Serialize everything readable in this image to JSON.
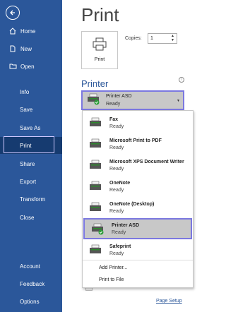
{
  "sidebar": {
    "items": [
      {
        "label": "Home",
        "icon": "home-icon"
      },
      {
        "label": "New",
        "icon": "new-document-icon"
      },
      {
        "label": "Open",
        "icon": "folder-icon"
      },
      {
        "label": "Info"
      },
      {
        "label": "Save"
      },
      {
        "label": "Save As"
      },
      {
        "label": "Print"
      },
      {
        "label": "Share"
      },
      {
        "label": "Export"
      },
      {
        "label": "Transform"
      },
      {
        "label": "Close"
      },
      {
        "label": "Account"
      },
      {
        "label": "Feedback"
      },
      {
        "label": "Options"
      }
    ],
    "active": "Print",
    "bg_color": "#2b579a"
  },
  "main": {
    "title": "Print",
    "print_button_label": "Print",
    "copies_label": "Copies:",
    "copies_value": "1",
    "printer_section_title": "Printer",
    "selected_printer": {
      "name": "Printer ASD",
      "status": "Ready"
    },
    "page_setup_label": "Page Setup"
  },
  "printer_dropdown": {
    "items": [
      {
        "name": "Fax",
        "status": "Ready"
      },
      {
        "name": "Microsoft Print to PDF",
        "status": "Ready"
      },
      {
        "name": "Microsoft XPS Document Writer",
        "status": "Ready"
      },
      {
        "name": "OneNote",
        "status": "Ready"
      },
      {
        "name": "OneNote (Desktop)",
        "status": "Ready"
      },
      {
        "name": "Printer ASD",
        "status": "Ready",
        "selected": true
      },
      {
        "name": "Safeprint",
        "status": "Ready"
      }
    ],
    "actions": [
      "Add Printer...",
      "Print to File"
    ],
    "highlight_color": "#7b78e0"
  }
}
